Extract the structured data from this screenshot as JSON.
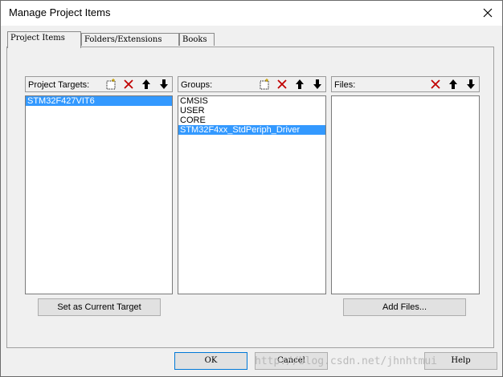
{
  "window": {
    "title": "Manage Project Items"
  },
  "tabs": [
    {
      "label": "Project Items",
      "active": true
    },
    {
      "label": "Folders/Extensions",
      "active": false
    },
    {
      "label": "Books",
      "active": false
    }
  ],
  "targets": {
    "label": "Project Targets:",
    "items": [
      "STM32F427VIT6"
    ],
    "selected_index": 0,
    "set_current_button": "Set as Current Target"
  },
  "groups": {
    "label": "Groups:",
    "items": [
      "CMSIS",
      "USER",
      "CORE",
      "STM32F4xx_StdPeriph_Driver"
    ],
    "selected_index": 3
  },
  "files": {
    "label": "Files:",
    "items": [],
    "add_button": "Add Files..."
  },
  "buttons": {
    "ok": "OK",
    "cancel": "Cancel",
    "help": "Help"
  },
  "watermark": "http://blog.csdn.net/jhnhtmui",
  "colors": {
    "selection": "#3399ff",
    "delete_icon": "#c00000"
  }
}
